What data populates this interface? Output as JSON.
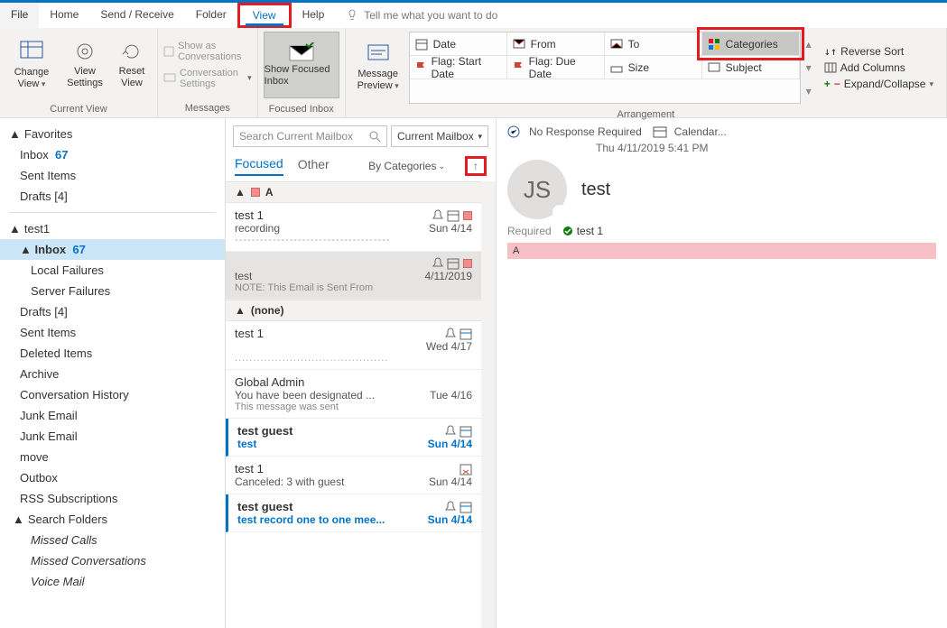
{
  "menubar": {
    "file": "File",
    "home": "Home",
    "sendreceive": "Send / Receive",
    "folder": "Folder",
    "view": "View",
    "help": "Help",
    "tellme": "Tell me what you want to do"
  },
  "ribbon": {
    "currentview": {
      "change": "Change View",
      "settings": "View Settings",
      "reset": "Reset View",
      "label": "Current View"
    },
    "messages": {
      "showconv": "Show as Conversations",
      "convset": "Conversation Settings",
      "label": "Messages"
    },
    "focused": {
      "btn": "Show Focused Inbox",
      "label": "Focused Inbox"
    },
    "preview": {
      "btn": "Message Preview",
      "label": ""
    },
    "arrangement": {
      "date": "Date",
      "from": "From",
      "to": "To",
      "categories": "Categories",
      "flagstart": "Flag: Start Date",
      "flagdue": "Flag: Due Date",
      "size": "Size",
      "subject": "Subject",
      "reverse": "Reverse Sort",
      "addcols": "Add Columns",
      "expand": "Expand/Collapse",
      "label": "Arrangement"
    }
  },
  "nav": {
    "favorites": "Favorites",
    "inbox": "Inbox",
    "inbox_count": "67",
    "sentitems": "Sent Items",
    "drafts": "Drafts [4]",
    "account": "test1",
    "localfail": "Local Failures",
    "serverfail": "Server Failures",
    "deleted": "Deleted Items",
    "archive": "Archive",
    "convhist": "Conversation History",
    "junk": "Junk Email",
    "move": "move",
    "outbox": "Outbox",
    "rss": "RSS Subscriptions",
    "searchfolders": "Search Folders",
    "missedcalls": "Missed Calls",
    "missedconv": "Missed Conversations",
    "voicemail": "Voice Mail"
  },
  "msglist": {
    "search_placeholder": "Search Current Mailbox",
    "scope": "Current Mailbox",
    "tab_focused": "Focused",
    "tab_other": "Other",
    "sortby": "By Categories",
    "groups": [
      {
        "name": "A",
        "color": true,
        "messages": [
          {
            "from": "test 1",
            "subj": "recording",
            "date": "Sun 4/14",
            "dash": true,
            "cat": true,
            "bell": true,
            "cal": true
          },
          {
            "from": "",
            "subj": "test",
            "date": "4/11/2019",
            "note": "NOTE: This Email is Sent From",
            "selected": true,
            "cat": true,
            "bell": true,
            "cal": true
          }
        ]
      },
      {
        "name": "(none)",
        "color": false,
        "messages": [
          {
            "from": "test 1",
            "subj": "",
            "date": "Wed 4/17",
            "dots": true,
            "bell": true,
            "cal2": true
          },
          {
            "from": "Global Admin",
            "subj": "You have been designated ...",
            "date": "Tue 4/16",
            "note": "This message was sent"
          },
          {
            "from": "test guest",
            "subj": "test",
            "date": "Sun 4/14",
            "unread": true,
            "bell": true,
            "cal2": true
          },
          {
            "from": "test 1",
            "subj": "Canceled: 3 with guest",
            "date": "Sun 4/14",
            "calx": true
          },
          {
            "from": "test guest",
            "subj": "test record one to one mee...",
            "date": "Sun 4/14",
            "unread": true,
            "bell": true,
            "cal2": true
          }
        ]
      }
    ]
  },
  "reading": {
    "noresp": "No Response Required",
    "calendar": "Calendar...",
    "datetime": "Thu 4/11/2019 5:41 PM",
    "initials": "JS",
    "subject": "test",
    "required": "Required",
    "attendee": "test 1",
    "category": "A"
  }
}
